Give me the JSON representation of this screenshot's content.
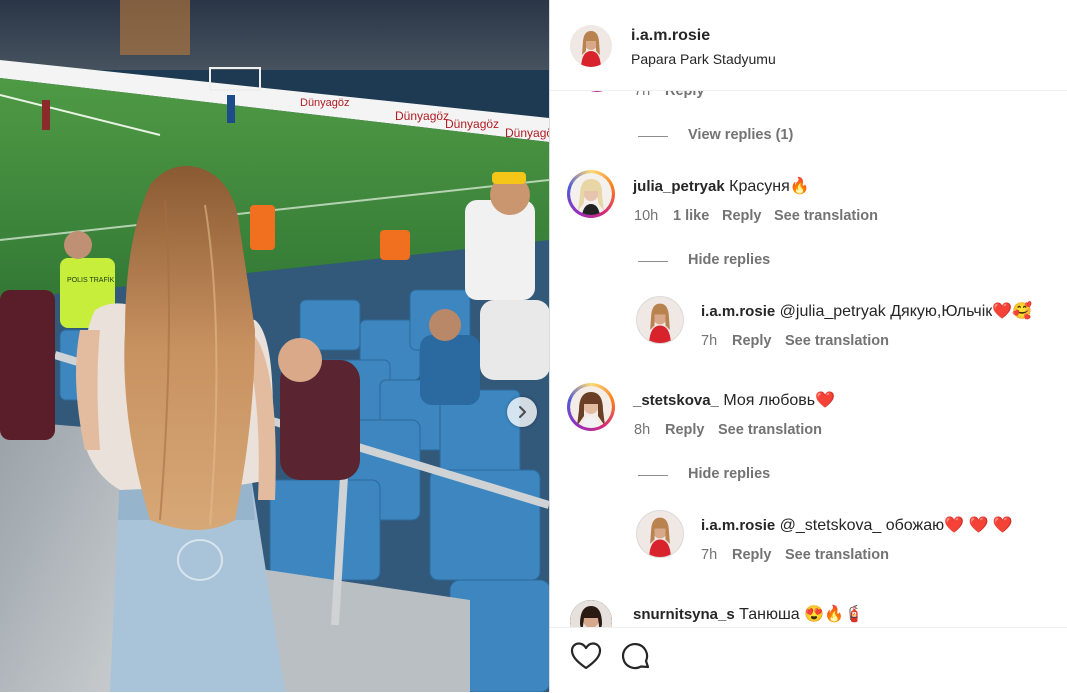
{
  "post": {
    "username": "i.a.m.rosie",
    "location": "Papara Park Stadyumu"
  },
  "photo": {
    "ads": [
      "Dünyagöz",
      "Dünyagöz",
      "Dünyagöz",
      "Dünyagöz",
      "Dünyagöz"
    ],
    "steward_vest": "POLIS TRAFİK",
    "next_icon": "chevron-right-icon"
  },
  "comments": {
    "partial_top": {
      "time": "7h",
      "reply": "Reply"
    },
    "view_replies": "View replies (1)",
    "items": [
      {
        "username": "julia_petryak",
        "text": "Красуня",
        "emoji": "🔥",
        "time": "10h",
        "likes": "1 like",
        "reply": "Reply",
        "translate": "See translation",
        "hide": "Hide replies",
        "replies": [
          {
            "username": "i.a.m.rosie",
            "mention": "@julia_petryak",
            "text": "Дякую,Юльчік",
            "emoji": "❤️🥰",
            "time": "7h",
            "reply": "Reply",
            "translate": "See translation"
          }
        ]
      },
      {
        "username": "_stetskova_",
        "text": "Моя любовь",
        "emoji": "❤️",
        "time": "8h",
        "reply": "Reply",
        "translate": "See translation",
        "hide": "Hide replies",
        "replies": [
          {
            "username": "i.a.m.rosie",
            "mention": "@_stetskova_",
            "text": "обожаю",
            "emoji": "❤️ ❤️ ❤️",
            "time": "7h",
            "reply": "Reply",
            "translate": "See translation"
          }
        ]
      },
      {
        "username": "snurnitsyna_s",
        "text": "Танюша",
        "emoji": "😍🔥🧯"
      }
    ]
  },
  "actions": {
    "like_icon": "heart-icon",
    "comment_icon": "comment-icon"
  },
  "colors": {
    "pitch": "#3f8a3a",
    "seats": "#3d86c0",
    "jeans": "#a9c3d9",
    "hair": "#c08a55",
    "link": "#3a5a9a",
    "heart": "#e0252f"
  }
}
